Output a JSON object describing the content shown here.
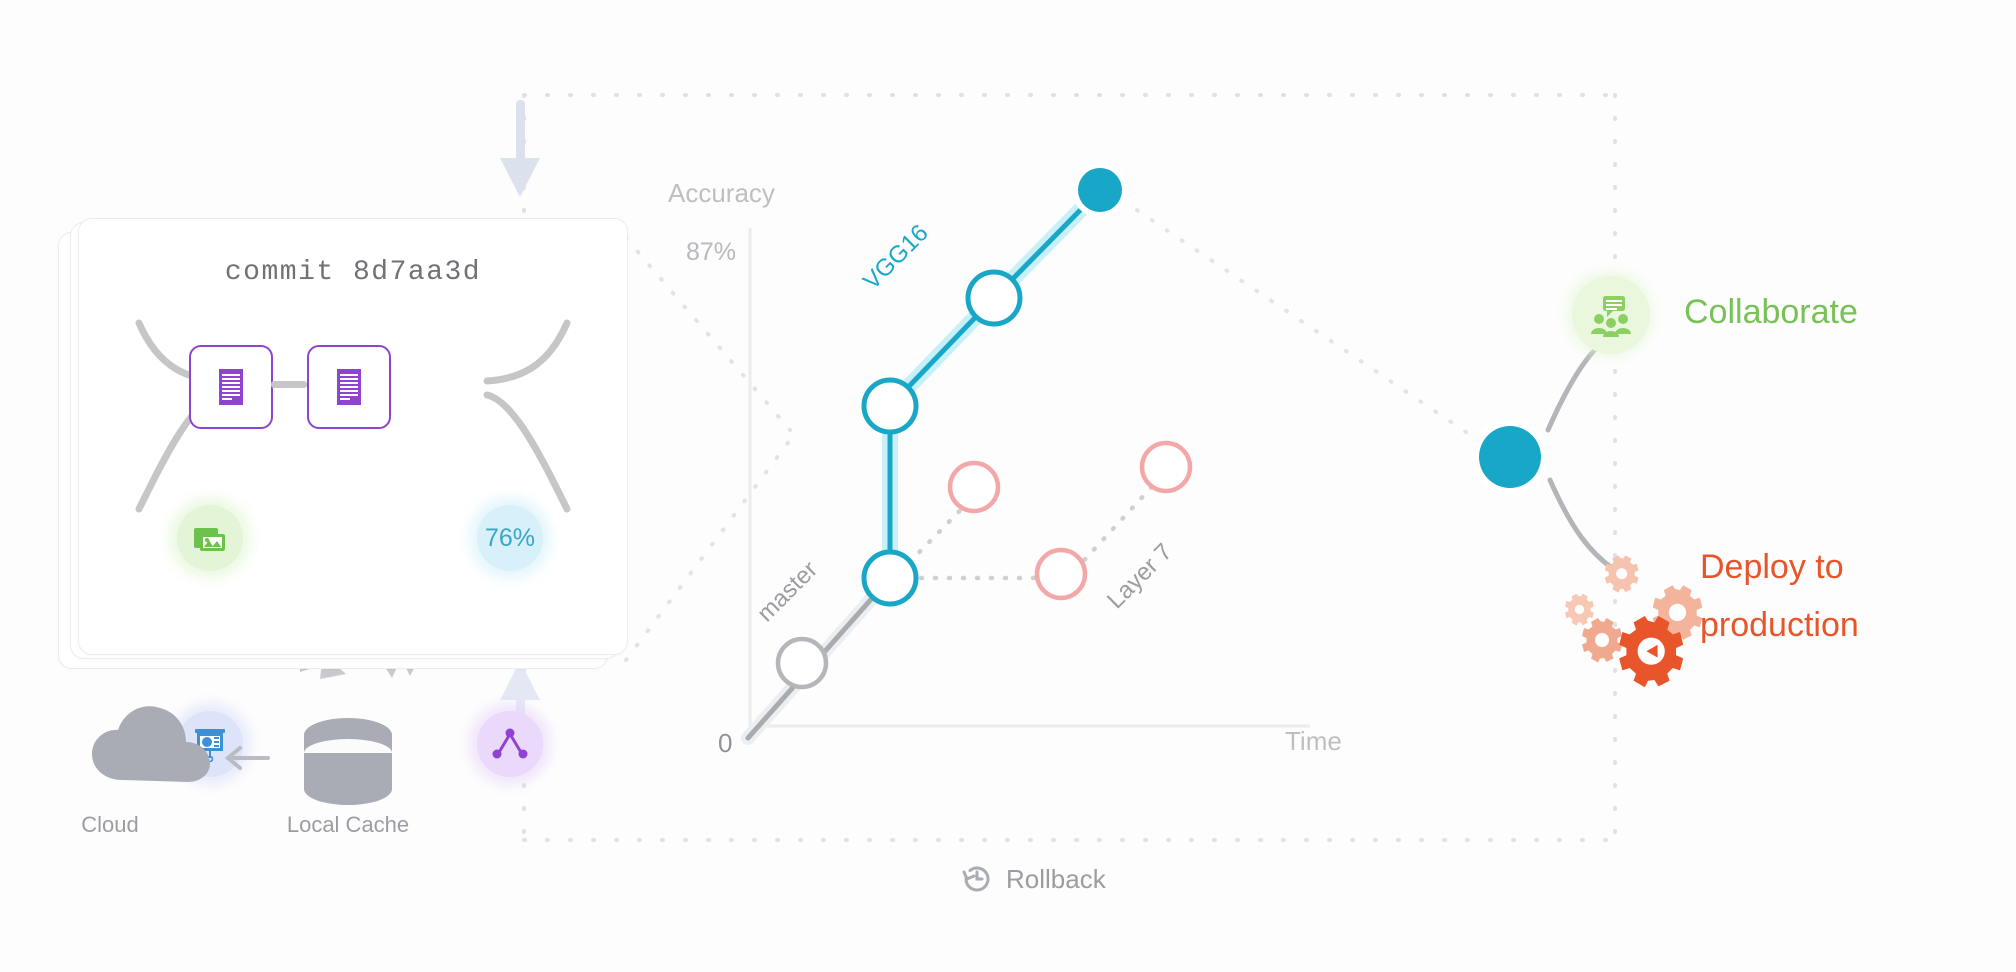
{
  "commit_card": {
    "title": "commit 8d7aa3d",
    "accuracy_badge": "76%",
    "nodes": [
      {
        "name": "images-icon",
        "color": "#6cc24a",
        "bg": "#e3f5d6"
      },
      {
        "name": "accuracy-badge",
        "color": "#3aa7c4",
        "bg": "#d7f0f9"
      },
      {
        "name": "presentation-chart-icon",
        "color": "#3d8fd6",
        "bg": "#dde4fa"
      },
      {
        "name": "model-graph-icon",
        "color": "#8e44d0",
        "bg": "#ead9fa"
      }
    ],
    "file_icon_name": "file-lines-icon"
  },
  "storage": {
    "cloud_label": "Cloud",
    "local_cache_label": "Local Cache",
    "arrow_name": "left-arrow-icon"
  },
  "chart_data": {
    "type": "line",
    "title": "",
    "xlabel": "Time",
    "ylabel": "Accuracy",
    "ytick_labels": [
      "87%"
    ],
    "xtick_labels": [
      "0"
    ],
    "grid": false,
    "legend": "inline-branch-labels",
    "series": [
      {
        "name": "master",
        "style": "solid-gray",
        "color": "#a9abaf",
        "points": [
          {
            "x": 0,
            "y": 0
          },
          {
            "x": 80,
            "y": 78
          }
        ]
      },
      {
        "name": "VGG16",
        "style": "solid-teal",
        "color": "#19a7c8",
        "points": [
          {
            "x": 142,
            "y": 78
          },
          {
            "x": 142,
            "y": 250
          },
          {
            "x": 244,
            "y": 354
          },
          {
            "x": 352,
            "y": 460
          }
        ],
        "head_value": "87%"
      },
      {
        "name": "Layer 7",
        "style": "dotted-pink",
        "color": "#f1a0a0",
        "points": [
          {
            "x": 142,
            "y": 78
          },
          {
            "x": 276,
            "y": 78
          },
          {
            "x": 362,
            "y": 172
          }
        ],
        "extra_point": {
          "x": 208,
          "y": 142
        }
      }
    ]
  },
  "flow": {
    "collaborate_label": "Collaborate",
    "deploy_label_line1": "Deploy to",
    "deploy_label_line2": "production",
    "collaborate_icon": "people-chat-icon",
    "deploy_icon": "gears-icon",
    "hub_node": "commit-hub-node"
  },
  "rollback": {
    "label": "Rollback",
    "icon": "clock-rewind-icon"
  },
  "colors": {
    "teal": "#19a7c8",
    "teal_dark": "#1597b5",
    "pink": "#f1a0a0",
    "green": "#77c157",
    "orange": "#e8552a",
    "purple": "#8e44d0",
    "gray": "#a9abaf",
    "light_gray": "#d9dadd"
  }
}
